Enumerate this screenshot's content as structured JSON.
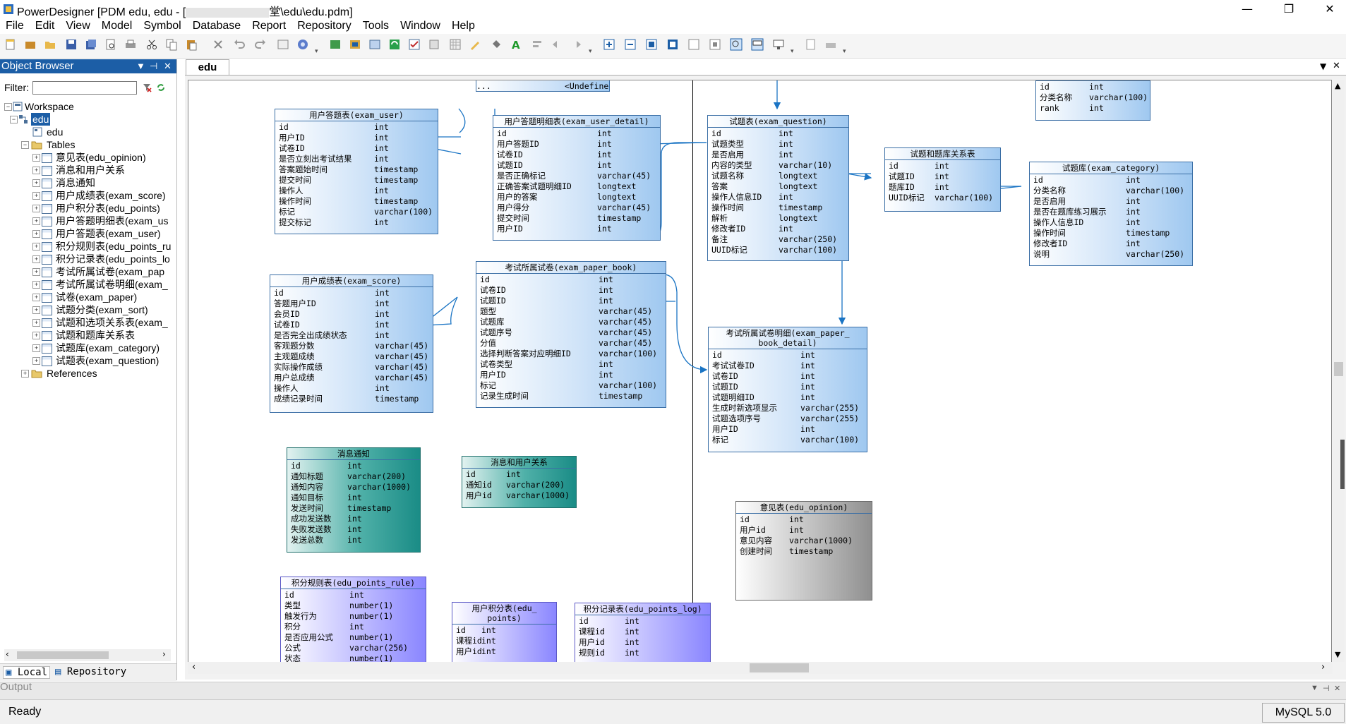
{
  "window": {
    "title": "PowerDesigner [PDM edu, edu - [",
    "title_suffix": "堂\\edu\\edu.pdm]",
    "controls": [
      "—",
      "❐",
      "✕"
    ]
  },
  "menu": [
    "File",
    "Edit",
    "View",
    "Model",
    "Symbol",
    "Database",
    "Report",
    "Repository",
    "Tools",
    "Window",
    "Help"
  ],
  "object_browser": {
    "title": "Object Browser",
    "filter_label": "Filter:",
    "tree": {
      "workspace": "Workspace",
      "model": "edu",
      "diagram": "edu",
      "tables_label": "Tables",
      "tables": [
        "意见表(edu_opinion)",
        "消息和用户关系",
        "消息通知",
        "用户成绩表(exam_score)",
        "用户积分表(edu_points)",
        "用户答题明细表(exam_us",
        "用户答题表(exam_user)",
        "积分规则表(edu_points_ru",
        "积分记录表(edu_points_lo",
        "考试所属试卷(exam_pap",
        "考试所属试卷明细(exam_",
        "试卷(exam_paper)",
        "试题分类(exam_sort)",
        "试题和选项关系表(exam_",
        "试题和题库关系表",
        "试题库(exam_category)",
        "试题表(exam_question)"
      ],
      "references": "References"
    },
    "bottom_tabs": [
      "Local",
      "Repository"
    ]
  },
  "document_tab": "edu",
  "entities": {
    "undefined_box": {
      "left": "...",
      "right": "<Undefined>"
    },
    "exam_user": {
      "title": "用户答题表(exam_user)",
      "rows": [
        [
          "id",
          "int"
        ],
        [
          "用户ID",
          "int"
        ],
        [
          "试卷ID",
          "int"
        ],
        [
          "是否立刻出考试结果",
          "int"
        ],
        [
          "答案题始时间",
          "timestamp"
        ],
        [
          "提交时间",
          "timestamp"
        ],
        [
          "操作人",
          "int"
        ],
        [
          "操作时间",
          "timestamp"
        ],
        [
          "标记",
          "varchar(100)"
        ],
        [
          "提交标记",
          "int"
        ]
      ]
    },
    "exam_user_detail": {
      "title": "用户答题明细表(exam_user_detail)",
      "rows": [
        [
          "id",
          "int"
        ],
        [
          "用户答题ID",
          "int"
        ],
        [
          "试卷ID",
          "int"
        ],
        [
          "试题ID",
          "int"
        ],
        [
          "是否正确标记",
          "varchar(45)"
        ],
        [
          "正确答案试题明细ID",
          "longtext"
        ],
        [
          "用户的答案",
          "longtext"
        ],
        [
          "用户得分",
          "varchar(45)"
        ],
        [
          "提交时间",
          "timestamp"
        ],
        [
          "用户ID",
          "int"
        ]
      ]
    },
    "exam_question": {
      "title": "试题表(exam_question)",
      "rows": [
        [
          "id",
          "int"
        ],
        [
          "试题类型",
          "int"
        ],
        [
          "是否启用",
          "int"
        ],
        [
          "内容的类型",
          "varchar(10)"
        ],
        [
          "试题名称",
          "longtext"
        ],
        [
          "答案",
          "longtext"
        ],
        [
          "操作人信息ID",
          "int"
        ],
        [
          "操作时间",
          "timestamp"
        ],
        [
          "解析",
          "longtext"
        ],
        [
          "修改者ID",
          "int"
        ],
        [
          "备注",
          "varchar(250)"
        ],
        [
          "UUID标记",
          "varchar(100)"
        ]
      ]
    },
    "exam_sort": {
      "title": "试题分类(exam_sort)",
      "rows": [
        [
          "id",
          "int"
        ],
        [
          "分类名称",
          "varchar(100)"
        ],
        [
          "rank",
          "int"
        ]
      ]
    },
    "question_category_rel": {
      "title": "试题和题库关系表",
      "rows": [
        [
          "id",
          "int"
        ],
        [
          "试题ID",
          "int"
        ],
        [
          "题库ID",
          "int"
        ],
        [
          "UUID标记",
          "varchar(100)"
        ]
      ]
    },
    "exam_category": {
      "title": "试题库(exam_category)",
      "rows": [
        [
          "id",
          "int"
        ],
        [
          "分类名称",
          "varchar(100)"
        ],
        [
          "是否启用",
          "int"
        ],
        [
          "是否在题库练习展示",
          "int"
        ],
        [
          "操作人信息ID",
          "int"
        ],
        [
          "操作时间",
          "timestamp"
        ],
        [
          "修改者ID",
          "int"
        ],
        [
          "说明",
          "varchar(250)"
        ]
      ]
    },
    "exam_score": {
      "title": "用户成绩表(exam_score)",
      "rows": [
        [
          "id",
          "int"
        ],
        [
          "答题用户ID",
          "int"
        ],
        [
          "会员ID",
          "int"
        ],
        [
          "试卷ID",
          "int"
        ],
        [
          "是否完全出成绩状态",
          "int"
        ],
        [
          "客观题分数",
          "varchar(45)"
        ],
        [
          "主观题成绩",
          "varchar(45)"
        ],
        [
          "实际操作成绩",
          "varchar(45)"
        ],
        [
          "用户总成绩",
          "varchar(45)"
        ],
        [
          "操作人",
          "int"
        ],
        [
          "成绩记录时间",
          "timestamp"
        ]
      ]
    },
    "exam_paper_book": {
      "title": "考试所属试卷(exam_paper_book)",
      "rows": [
        [
          "id",
          "int"
        ],
        [
          "试卷ID",
          "int"
        ],
        [
          "试题ID",
          "int"
        ],
        [
          "题型",
          "varchar(45)"
        ],
        [
          "试题库",
          "varchar(45)"
        ],
        [
          "试题序号",
          "varchar(45)"
        ],
        [
          "分值",
          "varchar(45)"
        ],
        [
          "选择判断答案对应明细ID",
          "varchar(100)"
        ],
        [
          "试卷类型",
          "int"
        ],
        [
          "用户ID",
          "int"
        ],
        [
          "标记",
          "varchar(100)"
        ],
        [
          "记录生成时间",
          "timestamp"
        ]
      ]
    },
    "exam_paper_book_detail": {
      "title": "考试所属试卷明细(exam_paper_\nbook_detail)",
      "rows": [
        [
          "id",
          "int"
        ],
        [
          "考试试卷ID",
          "int"
        ],
        [
          "试卷ID",
          "int"
        ],
        [
          "试题ID",
          "int"
        ],
        [
          "试题明细ID",
          "int"
        ],
        [
          "生成时新选项显示",
          "varchar(255)"
        ],
        [
          "试题选项序号",
          "varchar(255)"
        ],
        [
          "用户ID",
          "int"
        ],
        [
          "标记",
          "varchar(100)"
        ]
      ]
    },
    "message_notice": {
      "title": "消息通知",
      "rows": [
        [
          "id",
          "int"
        ],
        [
          "通知标题",
          "varchar(200)"
        ],
        [
          "通知内容",
          "varchar(1000)"
        ],
        [
          "通知目标",
          "int"
        ],
        [
          "发送时间",
          "timestamp"
        ],
        [
          "成功发送数",
          "int"
        ],
        [
          "失败发送数",
          "int"
        ],
        [
          "发送总数",
          "int"
        ]
      ]
    },
    "message_user_rel": {
      "title": "消息和用户关系",
      "rows": [
        [
          "id",
          "int"
        ],
        [
          "通知id",
          "varchar(200)"
        ],
        [
          "用户id",
          "varchar(1000)"
        ]
      ]
    },
    "edu_opinion": {
      "title": "意见表(edu_opinion)",
      "rows": [
        [
          "id",
          "int"
        ],
        [
          "用户id",
          "int"
        ],
        [
          "意见内容",
          "varchar(1000)"
        ],
        [
          "创建时间",
          "timestamp"
        ]
      ]
    },
    "edu_points_rule": {
      "title": "积分规则表(edu_points_rule)",
      "rows": [
        [
          "id",
          "int"
        ],
        [
          "类型",
          "number(1)"
        ],
        [
          "触发行为",
          "number(1)"
        ],
        [
          "积分",
          "int"
        ],
        [
          "是否应用公式",
          "number(1)"
        ],
        [
          "公式",
          "varchar(256)"
        ],
        [
          "状态",
          "number(1)"
        ]
      ]
    },
    "edu_points": {
      "title": "用户积分表(edu_\npoints)",
      "rows": [
        [
          "id",
          "int"
        ],
        [
          "课程id",
          "int"
        ],
        [
          "用户id",
          "int"
        ]
      ]
    },
    "edu_points_log": {
      "title": "积分记录表(edu_points_log)",
      "rows": [
        [
          "id",
          "int"
        ],
        [
          "课程id",
          "int"
        ],
        [
          "用户id",
          "int"
        ],
        [
          "规则id",
          "int"
        ]
      ]
    }
  },
  "output_label": "Output",
  "status": {
    "text": "Ready",
    "dbms": "MySQL 5.0"
  }
}
